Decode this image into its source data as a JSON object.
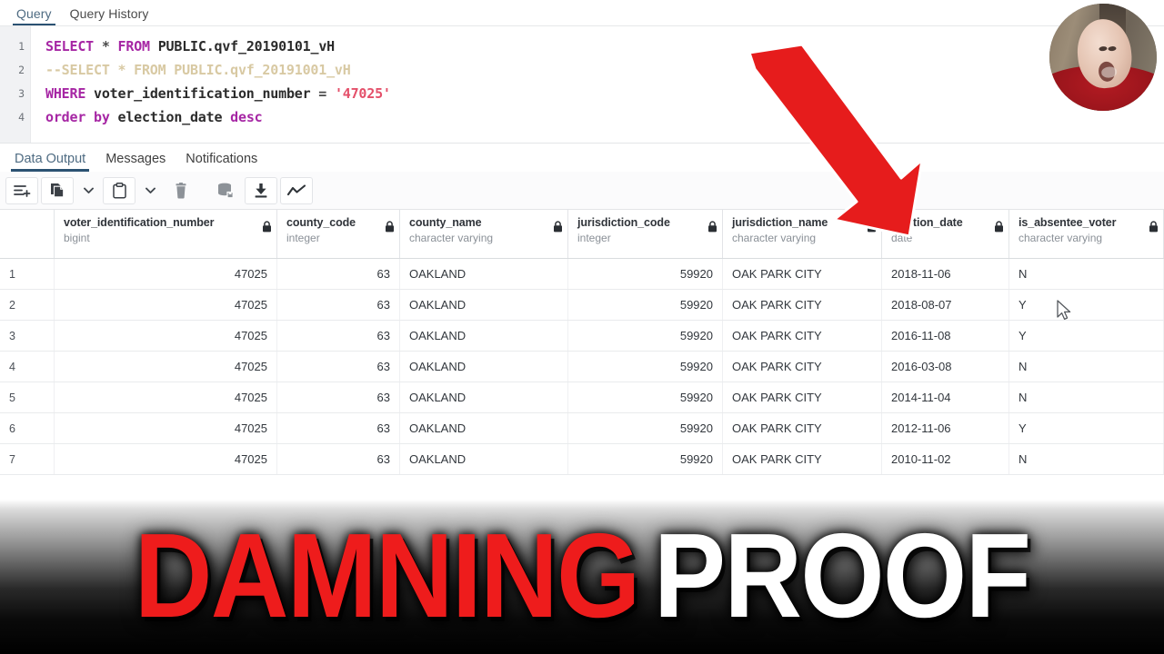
{
  "app": {
    "query_tabs": [
      {
        "label": "Query",
        "active": true
      },
      {
        "label": "Query History",
        "active": false
      }
    ],
    "output_tabs": [
      {
        "label": "Data Output",
        "active": true
      },
      {
        "label": "Messages",
        "active": false
      },
      {
        "label": "Notifications",
        "active": false
      }
    ]
  },
  "editor": {
    "line_numbers": [
      "1",
      "2",
      "3",
      "4"
    ],
    "lines": [
      {
        "n": "1",
        "tokens": [
          {
            "t": "SELECT",
            "c": "k"
          },
          {
            "t": " ",
            "c": "op"
          },
          {
            "t": "*",
            "c": "op"
          },
          {
            "t": " ",
            "c": "op"
          },
          {
            "t": "FROM",
            "c": "k"
          },
          {
            "t": " ",
            "c": "op"
          },
          {
            "t": "PUBLIC.qvf_20190101_vH",
            "c": "id"
          }
        ]
      },
      {
        "n": "2",
        "tokens": [
          {
            "t": "--SELECT * FROM PUBLIC.qvf_20191001_vH",
            "c": "cm"
          }
        ]
      },
      {
        "n": "3",
        "tokens": [
          {
            "t": "WHERE",
            "c": "k"
          },
          {
            "t": " ",
            "c": "op"
          },
          {
            "t": "voter_identification_number",
            "c": "id"
          },
          {
            "t": " = ",
            "c": "op"
          },
          {
            "t": "'47025'",
            "c": "st"
          }
        ]
      },
      {
        "n": "4",
        "tokens": [
          {
            "t": "order by",
            "c": "k"
          },
          {
            "t": " ",
            "c": "op"
          },
          {
            "t": "election_date",
            "c": "id"
          },
          {
            "t": " ",
            "c": "op"
          },
          {
            "t": "desc",
            "c": "k"
          }
        ]
      }
    ],
    "full_text": "SELECT * FROM PUBLIC.qvf_20190101_vH\n--SELECT * FROM PUBLIC.qvf_20191001_vH\nWHERE voter_identification_number = '47025'\norder by election_date desc"
  },
  "toolbar": {
    "buttons": [
      {
        "name": "add-row-icon",
        "title": "Add row"
      },
      {
        "name": "copy-icon",
        "title": "Copy"
      },
      {
        "name": "copy-chevron-icon",
        "title": "Copy options"
      },
      {
        "name": "paste-icon",
        "title": "Paste"
      },
      {
        "name": "paste-chevron-icon",
        "title": "Paste options"
      },
      {
        "name": "delete-icon",
        "title": "Delete"
      },
      {
        "name": "save-data-icon",
        "title": "Save data changes"
      },
      {
        "name": "download-icon",
        "title": "Download as CSV"
      },
      {
        "name": "graph-icon",
        "title": "Graph visualiser"
      }
    ]
  },
  "grid": {
    "columns": [
      {
        "name": "voter_identification_number",
        "type": "bigint",
        "align": "right"
      },
      {
        "name": "county_code",
        "type": "integer",
        "align": "right"
      },
      {
        "name": "county_name",
        "type": "character varying",
        "align": "left"
      },
      {
        "name": "jurisdiction_code",
        "type": "integer",
        "align": "right"
      },
      {
        "name": "jurisdiction_name",
        "type": "character varying",
        "align": "left"
      },
      {
        "name": "election_date",
        "type": "date",
        "align": "left"
      },
      {
        "name": "is_absentee_voter",
        "type": "character varying",
        "align": "left"
      }
    ],
    "rows": [
      {
        "n": "1",
        "v": [
          "47025",
          "63",
          "OAKLAND",
          "59920",
          "OAK PARK CITY",
          "2018-11-06",
          "N"
        ]
      },
      {
        "n": "2",
        "v": [
          "47025",
          "63",
          "OAKLAND",
          "59920",
          "OAK PARK CITY",
          "2018-08-07",
          "Y"
        ]
      },
      {
        "n": "3",
        "v": [
          "47025",
          "63",
          "OAKLAND",
          "59920",
          "OAK PARK CITY",
          "2016-11-08",
          "Y"
        ]
      },
      {
        "n": "4",
        "v": [
          "47025",
          "63",
          "OAKLAND",
          "59920",
          "OAK PARK CITY",
          "2016-03-08",
          "N"
        ]
      },
      {
        "n": "5",
        "v": [
          "47025",
          "63",
          "OAKLAND",
          "59920",
          "OAK PARK CITY",
          "2014-11-04",
          "N"
        ]
      },
      {
        "n": "6",
        "v": [
          "47025",
          "63",
          "OAKLAND",
          "59920",
          "OAK PARK CITY",
          "2012-11-06",
          "Y"
        ]
      },
      {
        "n": "7",
        "v": [
          "47025",
          "63",
          "OAKLAND",
          "59920",
          "OAK PARK CITY",
          "2010-11-02",
          "N"
        ]
      }
    ]
  },
  "overlays": {
    "banner": {
      "word1": "DAMNING",
      "word2": "PROOF",
      "word1_color": "#ee1c1c",
      "word2_color": "#ffffff"
    },
    "arrow": {
      "color": "#e61c1c",
      "points_to": "election_date"
    },
    "webcam": {
      "shape": "circle"
    }
  }
}
